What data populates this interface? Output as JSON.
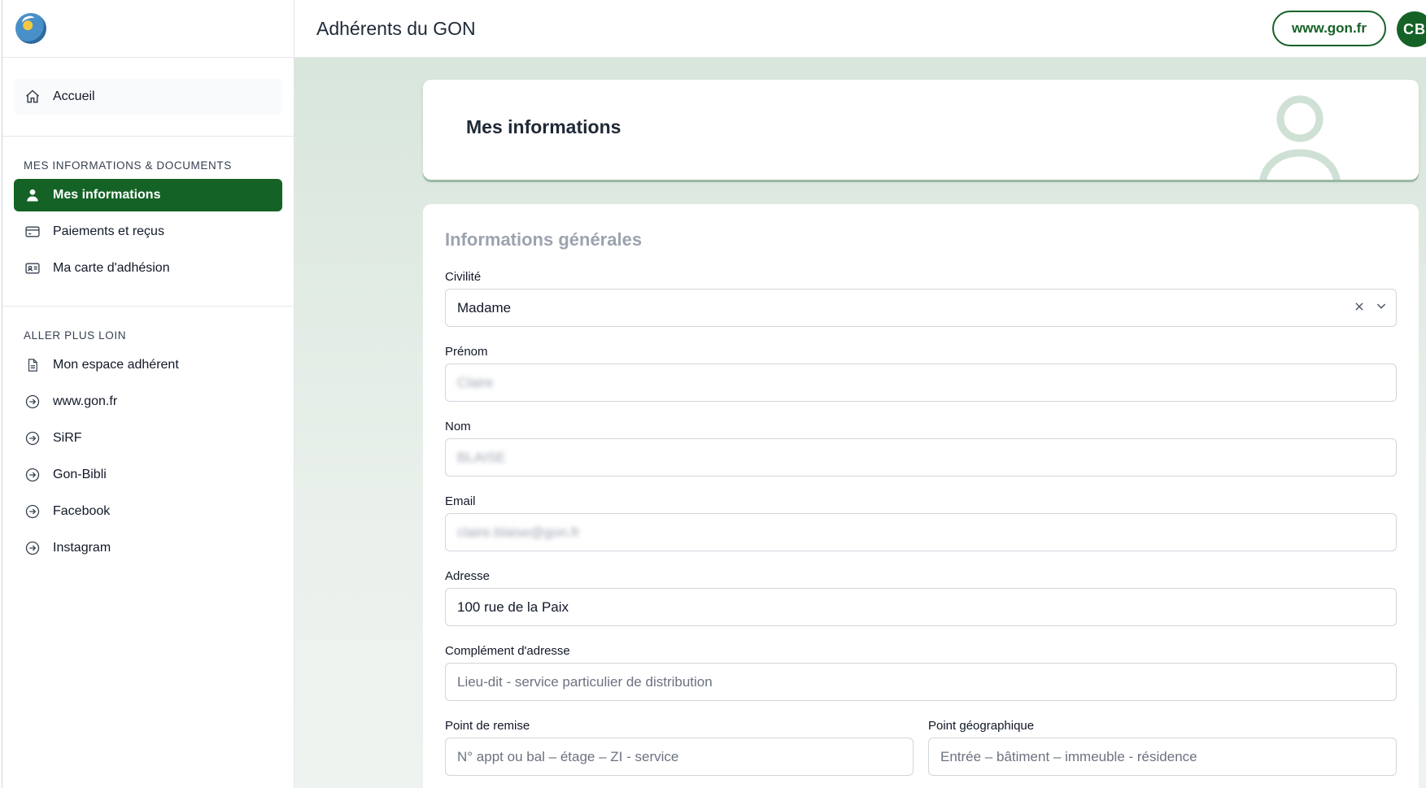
{
  "header": {
    "title": "Adhérents du GON",
    "site_button": "www.gon.fr",
    "avatar_initials": "CB"
  },
  "sidebar": {
    "home_label": "Accueil",
    "section1_title": "MES INFORMATIONS & DOCUMENTS",
    "section1_items": [
      {
        "label": "Mes informations",
        "icon": "user-icon",
        "active": true
      },
      {
        "label": "Paiements et reçus",
        "icon": "credit-card-icon"
      },
      {
        "label": "Ma carte d'adhésion",
        "icon": "id-card-icon"
      }
    ],
    "section2_title": "ALLER PLUS LOIN",
    "section2_items": [
      {
        "label": "Mon espace adhérent",
        "icon": "document-icon"
      },
      {
        "label": "www.gon.fr",
        "icon": "arrow-circle-icon"
      },
      {
        "label": "SiRF",
        "icon": "arrow-circle-icon"
      },
      {
        "label": "Gon-Bibli",
        "icon": "arrow-circle-icon"
      },
      {
        "label": "Facebook",
        "icon": "arrow-circle-icon"
      },
      {
        "label": "Instagram",
        "icon": "arrow-circle-icon"
      }
    ]
  },
  "hero": {
    "title": "Mes informations"
  },
  "form": {
    "title": "Informations générales",
    "civilite": {
      "label": "Civilité",
      "value": "Madame"
    },
    "prenom": {
      "label": "Prénom",
      "value": "Claire"
    },
    "nom": {
      "label": "Nom",
      "value": "BLAISE"
    },
    "email": {
      "label": "Email",
      "value": "claire.blaise@gon.fr"
    },
    "adresse": {
      "label": "Adresse",
      "value": "100 rue de la Paix"
    },
    "complement": {
      "label": "Complément d'adresse",
      "placeholder": "Lieu-dit - service particulier de distribution"
    },
    "point_remise": {
      "label": "Point de remise",
      "placeholder": "N° appt ou bal – étage – ZI - service"
    },
    "point_geo": {
      "label": "Point géographique",
      "placeholder": "Entrée – bâtiment – immeuble - résidence"
    }
  },
  "colors": {
    "brand_green": "#156227",
    "background_tint": "#d8e6dc"
  }
}
